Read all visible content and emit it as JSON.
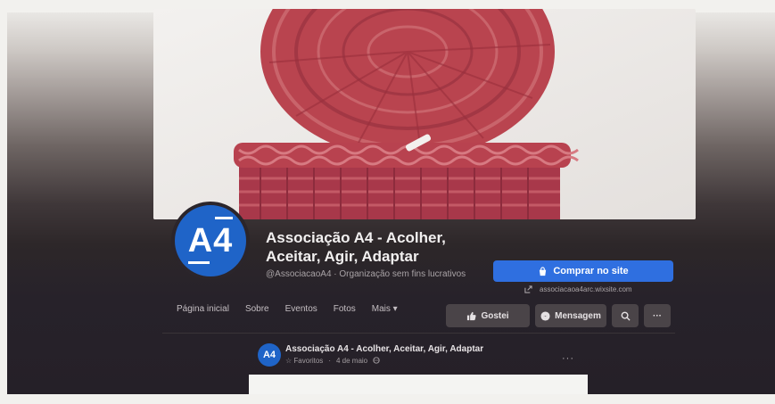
{
  "page": {
    "name": "Associação A4 - Acolher, Aceitar, Agir, Adaptar",
    "handle_category": "@AssociacaoA4 · Organização sem fins lucrativos",
    "avatar_text": "A4",
    "website": "associacaoa4arc.wixsite.com"
  },
  "actions": {
    "buy_label": "Comprar no site",
    "like_label": "Gostei",
    "message_label": "Mensagem",
    "more_label": "···"
  },
  "nav": {
    "items": [
      "Página inicial",
      "Sobre",
      "Eventos",
      "Fotos",
      "Mais ▾"
    ]
  },
  "post": {
    "author": "Associação A4 - Acolher, Aceitar, Agir, Adaptar",
    "favorites": "Favoritos",
    "time": "4 de maio",
    "more": "···"
  },
  "icons": {
    "buy": "shopping-bag-icon",
    "like": "thumbs-up-icon",
    "message": "messenger-icon",
    "search": "search-icon",
    "external": "external-link-icon",
    "globe": "globe-icon"
  },
  "colors": {
    "brand_blue": "#1f64c8",
    "primary_button": "#2f6fe0",
    "dark_surface": "#2b252b",
    "dark_button": "#4a4448"
  }
}
